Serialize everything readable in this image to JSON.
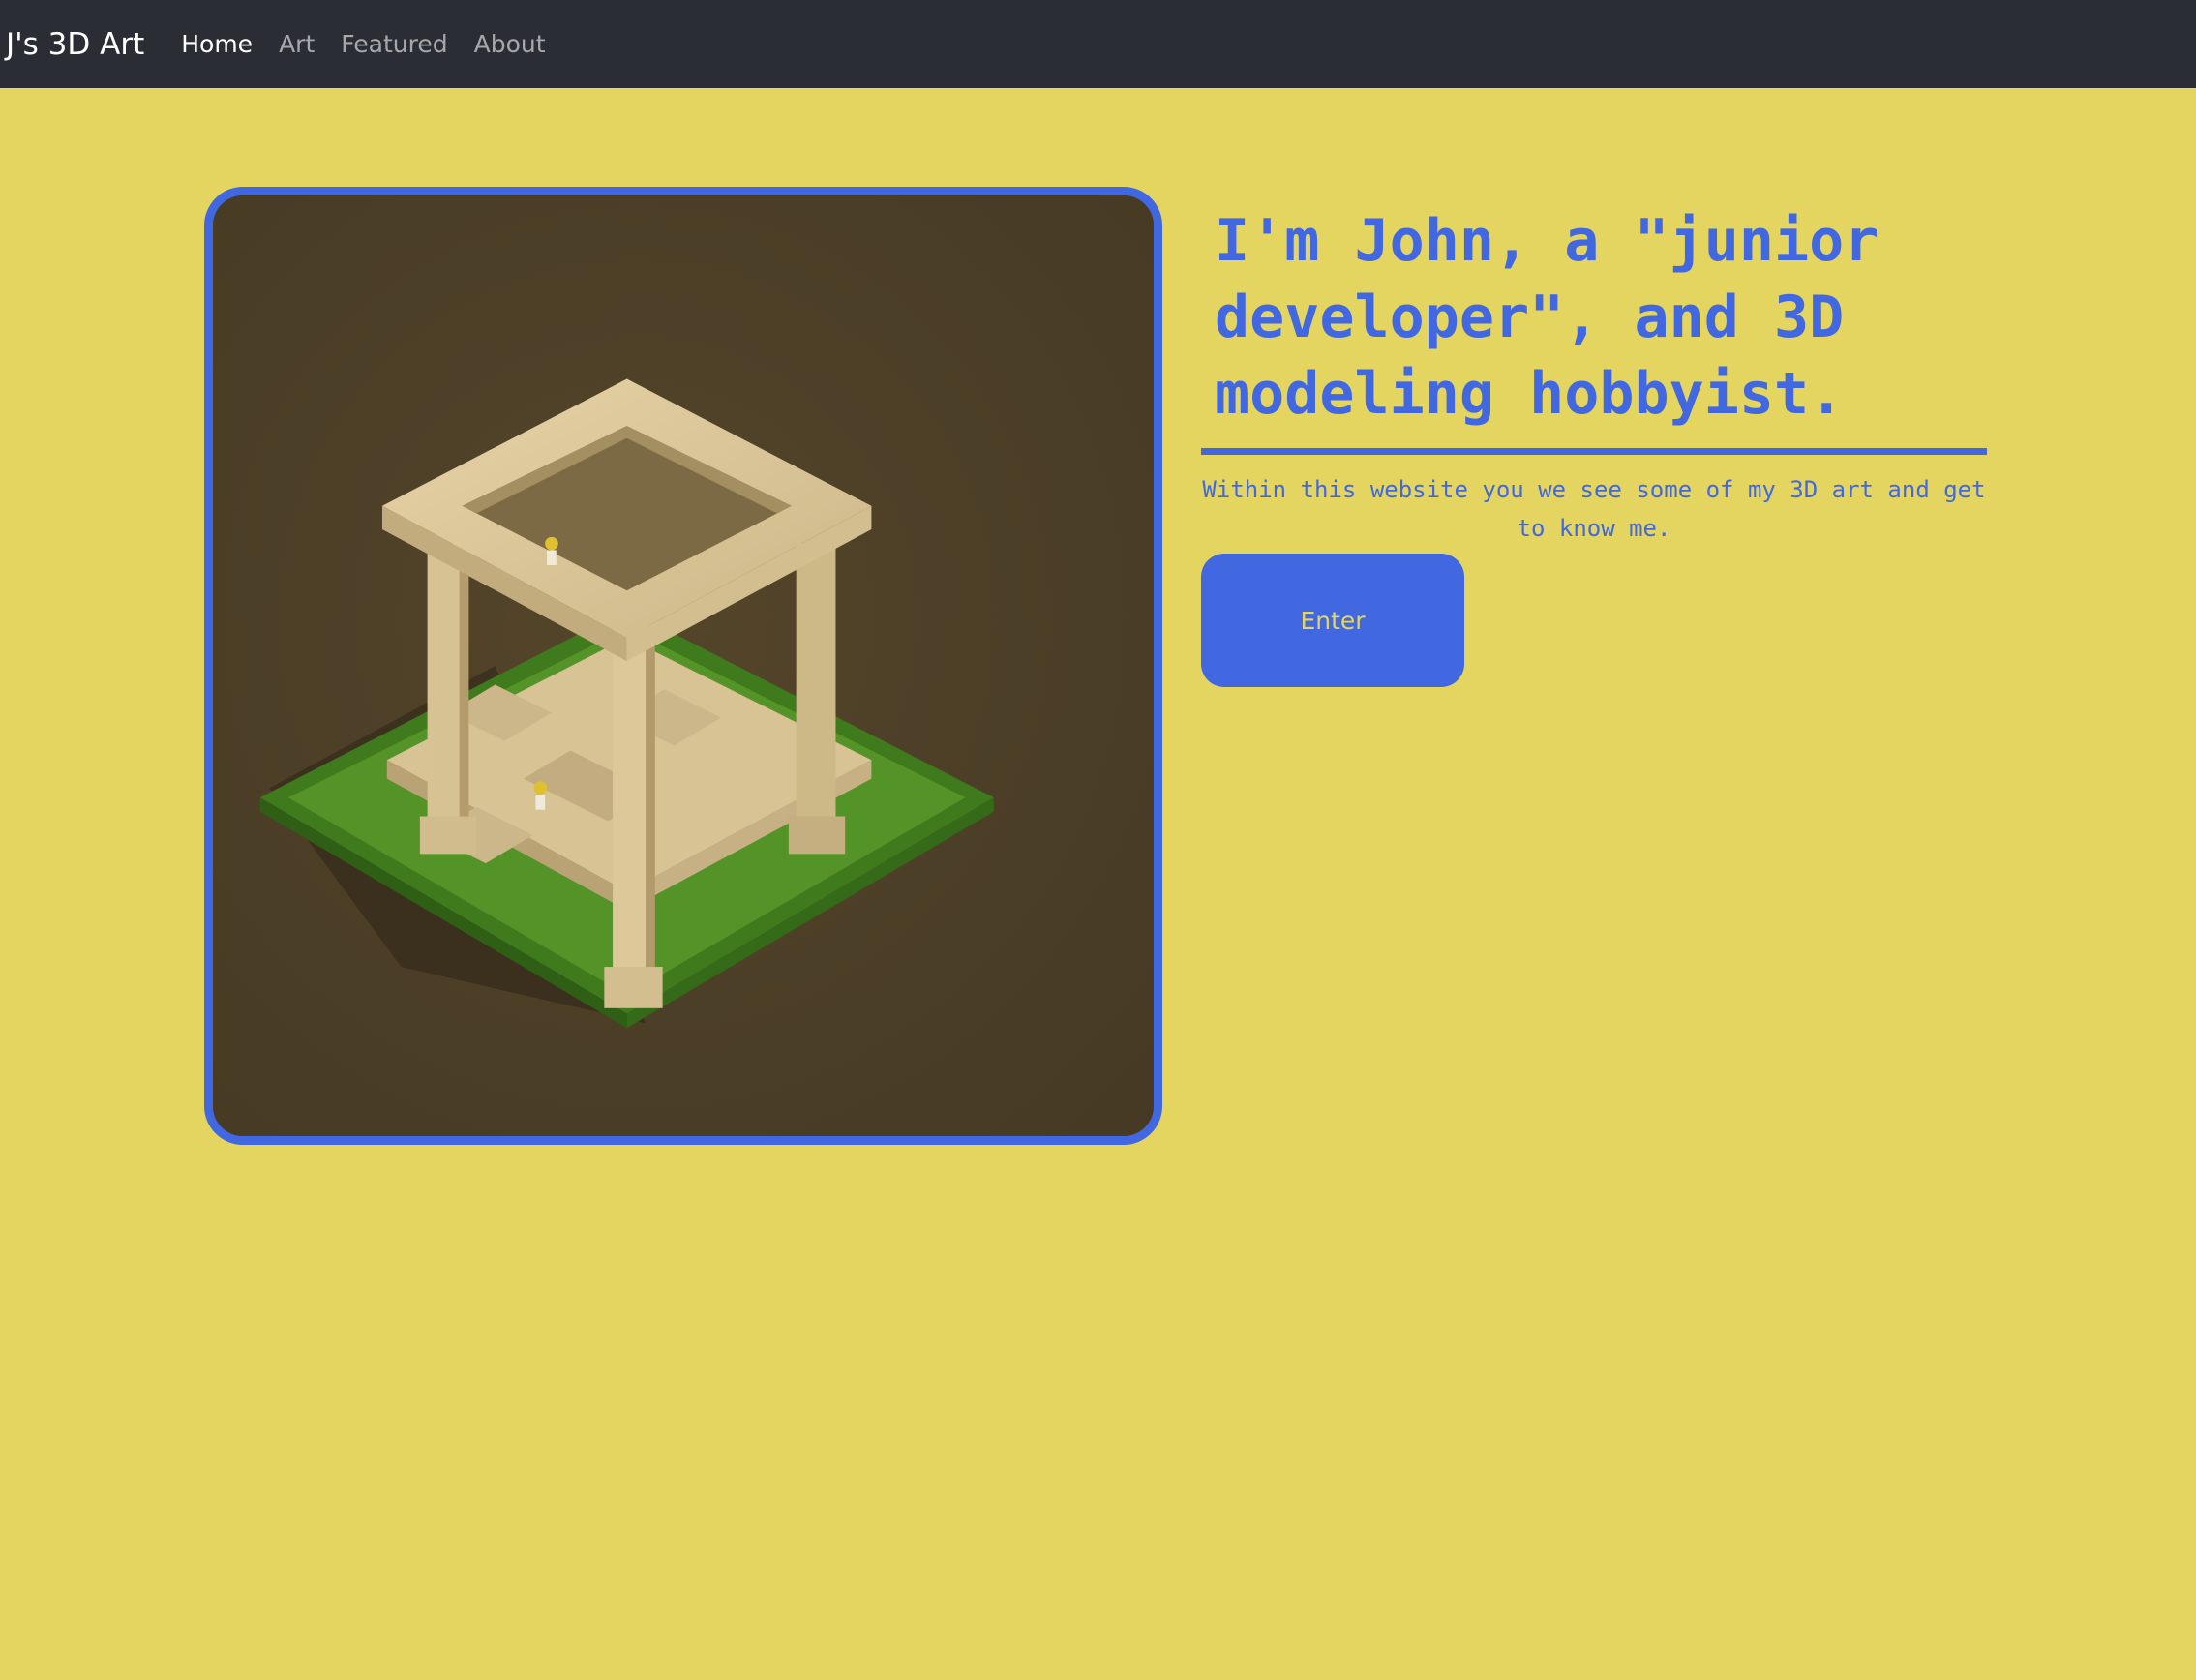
{
  "navbar": {
    "brand": "J's 3D Art",
    "links": [
      {
        "label": "Home",
        "active": true
      },
      {
        "label": "Art",
        "active": false
      },
      {
        "label": "Featured",
        "active": false
      },
      {
        "label": "About",
        "active": false
      }
    ]
  },
  "hero": {
    "headline": "I'm John, a \"junior developer\", and 3D modeling hobbyist.",
    "subtext": "Within this website you we see some of my 3D art and get to know me.",
    "button_label": "Enter",
    "image_subject": "isometric 3D render of a stone pavilion with columns on a grass square"
  },
  "colors": {
    "page_background": "#e3d55f",
    "navbar_background": "#2a2e34",
    "accent": "#4168e0",
    "image_background": "#4c3f27"
  }
}
